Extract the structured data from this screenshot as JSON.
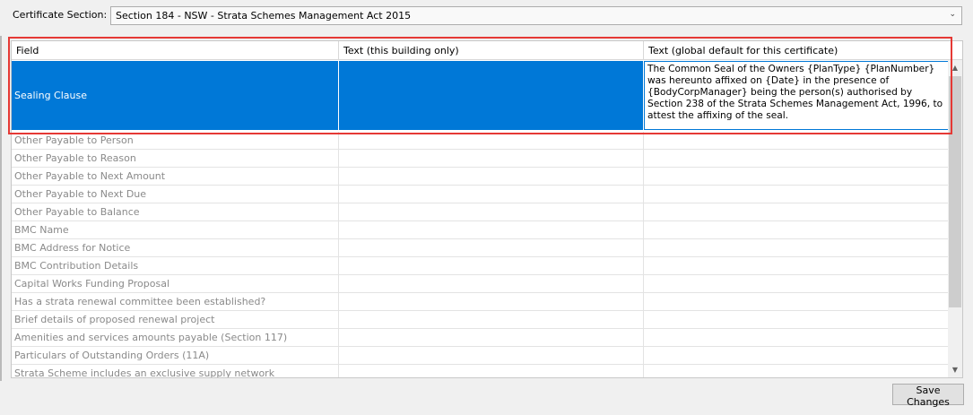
{
  "certificate_section": {
    "label": "Certificate Section:",
    "selected": "Section 184 - NSW - Strata Schemes Management Act 2015"
  },
  "grid": {
    "columns": [
      "Field",
      "Text (this building only)",
      "Text (global default for this certificate)"
    ],
    "selected_row": {
      "field": "Sealing Clause",
      "building_text": "",
      "global_text": "The Common Seal of the Owners {PlanType} {PlanNumber} was hereunto affixed on {Date} in the presence of {BodyCorpManager} being the person(s) authorised by Section 238 of the Strata Schemes Management Act, 1996, to attest the affixing of the seal."
    },
    "rows": [
      "Other Payable to Person",
      "Other Payable to Reason",
      "Other Payable to Next Amount",
      "Other Payable to Next Due",
      "Other Payable to Balance",
      "BMC Name",
      "BMC Address for Notice",
      "BMC Contribution Details",
      "Capital Works Funding Proposal",
      "Has a strata renewal committee been established?",
      "Brief details of proposed renewal project",
      "Amenities and services amounts payable (Section 117)",
      "Particulars of Outstanding Orders (11A)",
      "Strata Scheme includes an exclusive supply network"
    ]
  },
  "buttons": {
    "save": "Save Changes"
  },
  "colors": {
    "selection": "#0078d7",
    "highlight_box": "#e53935"
  }
}
